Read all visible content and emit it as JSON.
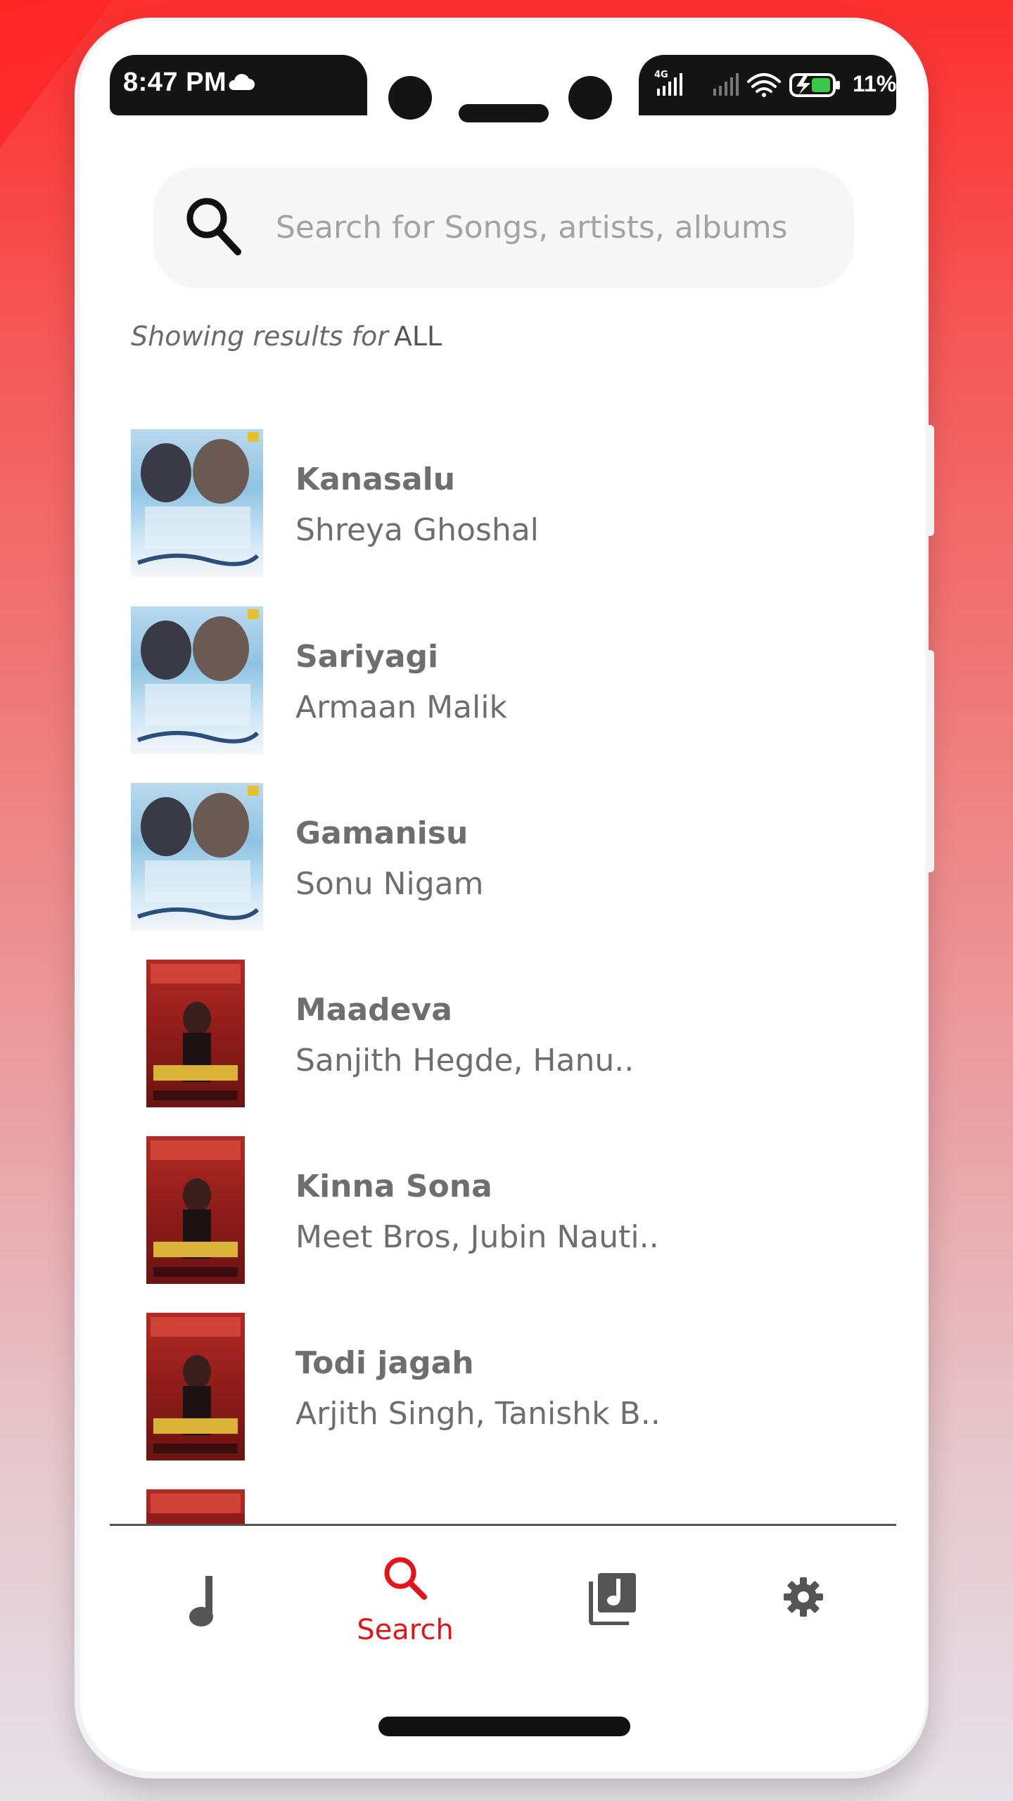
{
  "status_bar": {
    "time": "8:47 PM",
    "cloud_icon": "cloud-icon",
    "network_label": "4G",
    "battery_text": "11%"
  },
  "search": {
    "placeholder": "Search for Songs, artists, albums",
    "results_prefix": "Showing results for",
    "results_filter": "ALL"
  },
  "songs": [
    {
      "title": "Kanasalu",
      "artist": "Shreya Ghoshal",
      "art": "blue"
    },
    {
      "title": "Sariyagi",
      "artist": "Armaan Malik",
      "art": "blue"
    },
    {
      "title": "Gamanisu",
      "artist": "Sonu Nigam",
      "art": "blue"
    },
    {
      "title": "Maadeva",
      "artist": "Sanjith Hegde, Hanu..",
      "art": "red"
    },
    {
      "title": "Kinna Sona",
      "artist": "Meet Bros, Jubin Nauti..",
      "art": "red"
    },
    {
      "title": "Todi jagah",
      "artist": "Arjith Singh, Tanishk B..",
      "art": "red"
    }
  ],
  "bottom_nav": {
    "items": [
      {
        "icon": "music-note-icon",
        "label": "",
        "active": false
      },
      {
        "icon": "search-icon",
        "label": "Search",
        "active": true
      },
      {
        "icon": "library-icon",
        "label": "",
        "active": false
      },
      {
        "icon": "gear-icon",
        "label": "",
        "active": false
      }
    ]
  },
  "colors": {
    "accent": "#e0161a",
    "text_muted": "#6e6e6e",
    "status_bar_bg": "#141414"
  }
}
